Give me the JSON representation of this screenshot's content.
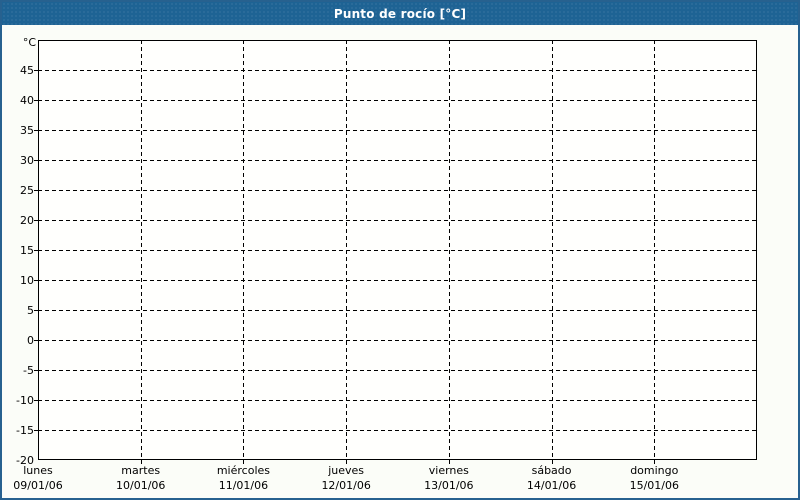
{
  "header": {
    "title": "Punto de rocío [°C]"
  },
  "colors": {
    "titlebar_bg": "#1e6394",
    "titlebar_text": "#ffffff",
    "page_border": "#27618f",
    "page_bg": "#fbfdf8",
    "plot_bg": "#fffffd",
    "grid_color": "#000000",
    "text_color": "#000000"
  },
  "chart_data": {
    "type": "line",
    "title": "Punto de rocío [°C]",
    "y_unit_label": "°C",
    "ylim": [
      -20,
      50
    ],
    "ytick_step": 5,
    "yticks": [
      45,
      40,
      35,
      30,
      25,
      20,
      15,
      10,
      5,
      0,
      -5,
      -10,
      -15,
      -20
    ],
    "x_days_span": 7,
    "x_categories": [
      {
        "day": "lunes",
        "date": "09/01/06"
      },
      {
        "day": "martes",
        "date": "10/01/06"
      },
      {
        "day": "miércoles",
        "date": "11/01/06"
      },
      {
        "day": "jueves",
        "date": "12/01/06"
      },
      {
        "day": "viernes",
        "date": "13/01/06"
      },
      {
        "day": "sábado",
        "date": "14/01/06"
      },
      {
        "day": "domingo",
        "date": "15/01/06"
      }
    ],
    "grid": "dashed",
    "legend": "none",
    "series": []
  }
}
